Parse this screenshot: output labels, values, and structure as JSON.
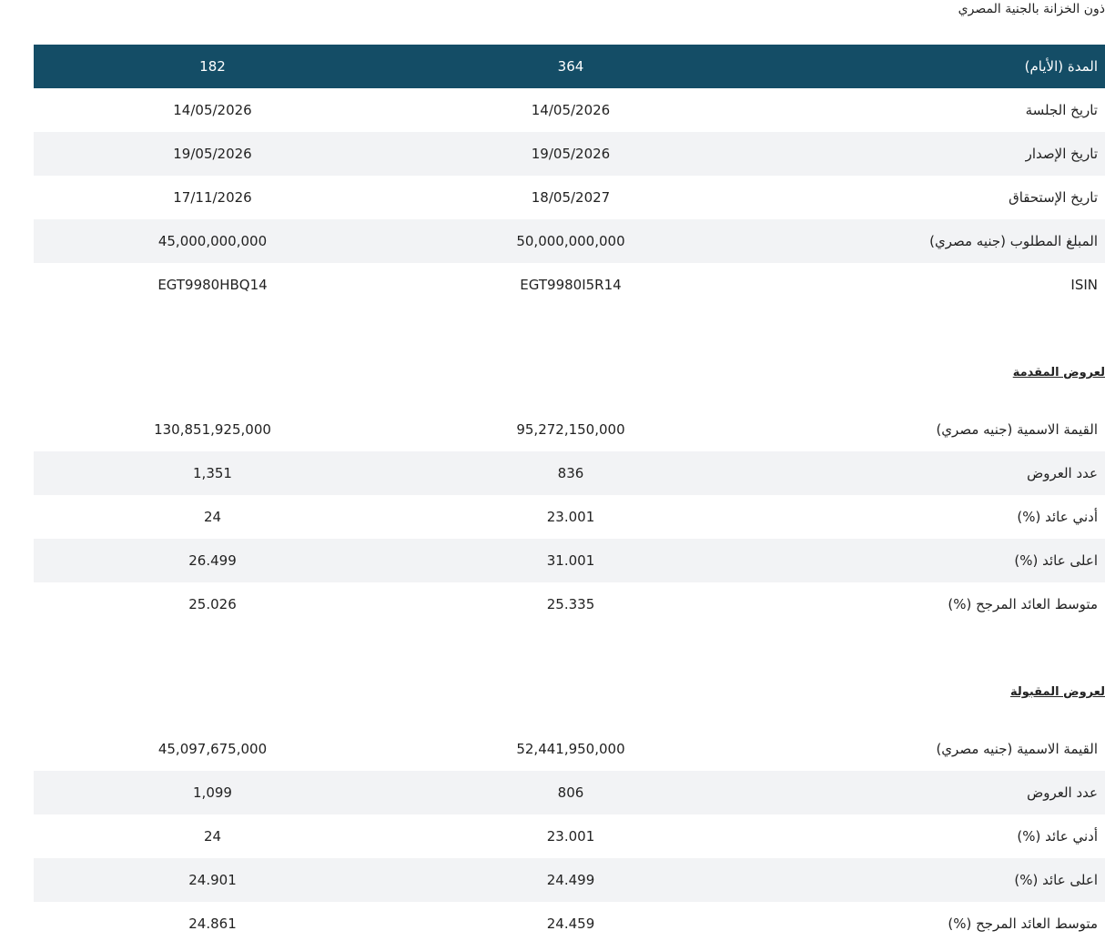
{
  "page_title": "ذون الخزانة بالجنية المصري",
  "header": {
    "label": "المدة (الأيام)",
    "col_a": "364",
    "col_b": "182"
  },
  "auction_info": [
    {
      "label": "تاريخ الجلسة",
      "col_a": "14/05/2026",
      "col_b": "14/05/2026"
    },
    {
      "label": "تاريخ الإصدار",
      "col_a": "19/05/2026",
      "col_b": "19/05/2026"
    },
    {
      "label": "تاريخ الإستحقاق",
      "col_a": "18/05/2027",
      "col_b": "17/11/2026"
    },
    {
      "label": "المبلغ المطلوب (جنيه مصري)",
      "col_a": "50,000,000,000",
      "col_b": "45,000,000,000"
    },
    {
      "label": "ISIN",
      "col_a": "EGT9980I5R14",
      "col_b": "EGT9980HBQ14"
    }
  ],
  "submitted_heading": "لعروض المقدمة",
  "submitted": [
    {
      "label": "القيمة الاسمية (جنيه مصري)",
      "col_a": "95,272,150,000",
      "col_b": "130,851,925,000"
    },
    {
      "label": "عدد العروض",
      "col_a": "836",
      "col_b": "1,351"
    },
    {
      "label": "أدني عائد (%)",
      "col_a": "23.001",
      "col_b": "24"
    },
    {
      "label": "اعلى عائد (%)",
      "col_a": "31.001",
      "col_b": "26.499"
    },
    {
      "label": "متوسط العائد المرجح (%)",
      "col_a": "25.335",
      "col_b": "25.026"
    }
  ],
  "accepted_heading": "لعروض المقبولة",
  "accepted": [
    {
      "label": "القيمة الاسمية (جنيه مصري)",
      "col_a": "52,441,950,000",
      "col_b": "45,097,675,000"
    },
    {
      "label": "عدد العروض",
      "col_a": "806",
      "col_b": "1,099"
    },
    {
      "label": "أدني عائد (%)",
      "col_a": "23.001",
      "col_b": "24"
    },
    {
      "label": "اعلى عائد (%)",
      "col_a": "24.499",
      "col_b": "24.901"
    },
    {
      "label": "متوسط العائد المرجح (%)",
      "col_a": "24.459",
      "col_b": "24.861"
    }
  ],
  "colors": {
    "header_bg": "#144d66",
    "alt_row_bg": "#f2f3f5"
  }
}
